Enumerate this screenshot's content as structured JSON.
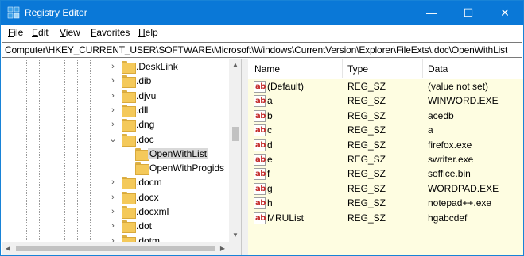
{
  "window": {
    "title": "Registry Editor",
    "accent_color": "#0a78d7",
    "controls": {
      "minimize": "—",
      "maximize": "☐",
      "close": "✕"
    }
  },
  "menu": [
    {
      "label": "File",
      "underline": "F",
      "rest": "ile"
    },
    {
      "label": "Edit",
      "underline": "E",
      "rest": "dit"
    },
    {
      "label": "View",
      "underline": "V",
      "rest": "iew"
    },
    {
      "label": "Favorites",
      "underline": "F",
      "rest": "avorites",
      "prefix": "",
      "underline_index": 0
    },
    {
      "label": "Help",
      "underline": "H",
      "rest": "elp"
    }
  ],
  "address": "Computer\\HKEY_CURRENT_USER\\SOFTWARE\\Microsoft\\Windows\\CurrentVersion\\Explorer\\FileExts\\.doc\\OpenWithList",
  "tree": {
    "items": [
      {
        "label": ".DeskLink",
        "chevron": "›",
        "selected": false
      },
      {
        "label": ".dib",
        "chevron": "›",
        "selected": false
      },
      {
        "label": ".djvu",
        "chevron": "›",
        "selected": false
      },
      {
        "label": ".dll",
        "chevron": "›",
        "selected": false
      },
      {
        "label": ".dng",
        "chevron": "›",
        "selected": false
      },
      {
        "label": ".doc",
        "chevron": "⌄",
        "selected": false
      },
      {
        "label": "OpenWithList",
        "chevron": "",
        "selected": true
      },
      {
        "label": "OpenWithProgids",
        "chevron": "",
        "selected": false
      },
      {
        "label": ".docm",
        "chevron": "›",
        "selected": false
      },
      {
        "label": ".docx",
        "chevron": "›",
        "selected": false
      },
      {
        "label": ".docxml",
        "chevron": "›",
        "selected": false
      },
      {
        "label": ".dot",
        "chevron": "›",
        "selected": false
      },
      {
        "label": ".dotm",
        "chevron": "›",
        "selected": false
      }
    ]
  },
  "list": {
    "columns": {
      "name": "Name",
      "type": "Type",
      "data": "Data"
    },
    "icon_text": "ab",
    "rows": [
      {
        "name": "(Default)",
        "type": "REG_SZ",
        "data": "(value not set)"
      },
      {
        "name": "a",
        "type": "REG_SZ",
        "data": "WINWORD.EXE"
      },
      {
        "name": "b",
        "type": "REG_SZ",
        "data": "acedb"
      },
      {
        "name": "c",
        "type": "REG_SZ",
        "data": "a"
      },
      {
        "name": "d",
        "type": "REG_SZ",
        "data": "firefox.exe"
      },
      {
        "name": "e",
        "type": "REG_SZ",
        "data": "swriter.exe"
      },
      {
        "name": "f",
        "type": "REG_SZ",
        "data": "soffice.bin"
      },
      {
        "name": "g",
        "type": "REG_SZ",
        "data": "WORDPAD.EXE"
      },
      {
        "name": "h",
        "type": "REG_SZ",
        "data": "notepad++.exe"
      },
      {
        "name": "MRUList",
        "type": "REG_SZ",
        "data": "hgabcdef"
      }
    ],
    "row_highlight_color": "#fefde1"
  }
}
